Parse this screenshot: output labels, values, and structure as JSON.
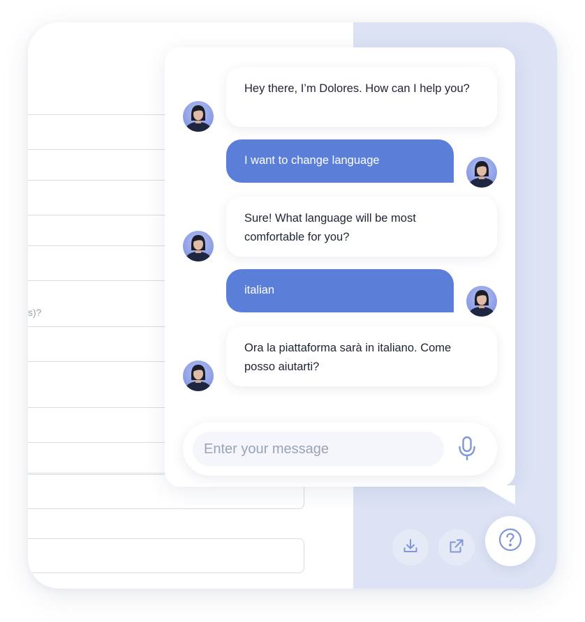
{
  "form": {
    "partial_question": "s)?"
  },
  "chat": {
    "messages": [
      {
        "sender": "bot",
        "text": "Hey there, I’m Dolores. How can I help you?"
      },
      {
        "sender": "user",
        "text": "I want to change language"
      },
      {
        "sender": "bot",
        "text": "Sure! What language will be most comfortable for you?"
      },
      {
        "sender": "user",
        "text": "italian"
      },
      {
        "sender": "bot",
        "text": "Ora la piattaforma sarà in italiano. Come posso aiutarti?"
      }
    ],
    "input": {
      "value": "",
      "placeholder": "Enter your message"
    },
    "icons": {
      "mic": "microphone-icon",
      "download": "download-icon",
      "external": "external-link-icon",
      "help": "help-question-icon"
    }
  },
  "colors": {
    "accent": "#5b7fd9",
    "panel_background": "#dde3f5",
    "icon": "#7f97d9"
  }
}
